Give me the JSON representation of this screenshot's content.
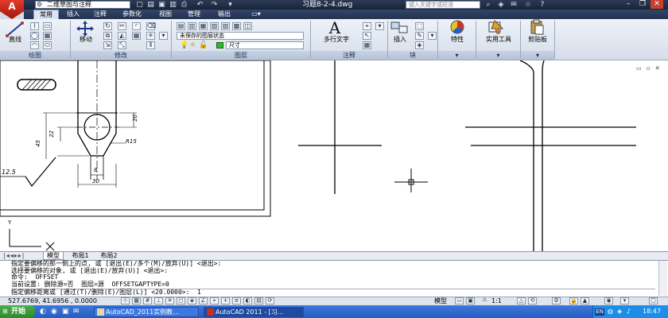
{
  "window": {
    "workspace": "二维草图与注释",
    "title": "习题8-2-4.dwg",
    "search_placeholder": "键入关键字或短语",
    "logo": "A"
  },
  "ribbon_tabs": [
    "常用",
    "插入",
    "注释",
    "参数化",
    "视图",
    "管理",
    "输出"
  ],
  "ribbon": {
    "draw": {
      "title": "绘图",
      "line_label": "直线"
    },
    "modify": {
      "title": "修改",
      "move_label": "移动"
    },
    "layers": {
      "title": "图层",
      "layer_state": "未保存的图层状态",
      "current_layer": "尺寸"
    },
    "annotation": {
      "title": "注释",
      "mtext_label": "多行文字"
    },
    "block": {
      "title": "块",
      "insert_label": "插入"
    },
    "properties": {
      "label": "特性"
    },
    "utilities": {
      "label": "实用工具"
    },
    "clipboard": {
      "label": "剪贴板"
    }
  },
  "drawing": {
    "dims": {
      "d20": "20",
      "d22": "22",
      "d45": "45",
      "d8": "8",
      "d30": "30",
      "r15": "R15",
      "rough": "12.5"
    },
    "ucs_y": "Y"
  },
  "layout_tabs": [
    "模型",
    "布局1",
    "布局2"
  ],
  "command_lines": [
    "指定要偏移的那一侧上的点, 或 [退出(E)/多个(M)/放弃(U)] <退出>:",
    "选择要偏移的对象, 或 [退出(E)/放弃(U)] <退出>:",
    "命令:  OFFSET",
    "当前设置: 删除源=否  图层=源  OFFSETGAPTYPE=0",
    "指定偏移距离或 [通过(T)/删除(E)/图层(L)] <20.0000>:  1"
  ],
  "status": {
    "coords": "527.6769, 41.6956 , 0.0000",
    "model": "模型",
    "scale": "1:1"
  },
  "taskbar": {
    "start": "开始",
    "tasks": [
      "AutoCAD_2011实例教...",
      "AutoCAD 2011 - [习..."
    ],
    "lang": "EN",
    "clock": "18:47"
  }
}
